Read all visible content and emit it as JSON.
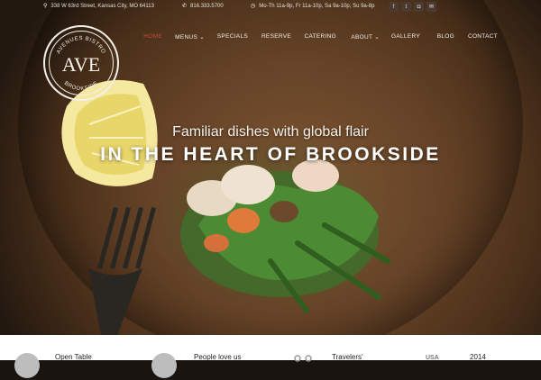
{
  "topbar": {
    "address": "338 W 63rd Street, Kansas City, MO 64113",
    "phone": "816.333.5700",
    "hours": "Mo-Th 11a-9p, Fr 11a-10p, Sa 9a-10p, Su 9a-8p",
    "social": [
      {
        "icon": "facebook-icon",
        "glyph": "f"
      },
      {
        "icon": "twitter-icon",
        "glyph": "t"
      },
      {
        "icon": "instagram-icon",
        "glyph": "◘"
      },
      {
        "icon": "email-icon",
        "glyph": "✉"
      }
    ]
  },
  "logo": {
    "arc_top": "AVENUES BISTRO",
    "monogram": "AVE",
    "arc_bottom": "BROOKSIDE"
  },
  "nav": {
    "items": [
      {
        "label": "HOME",
        "active": true
      },
      {
        "label": "MENUS",
        "dropdown": true
      },
      {
        "label": "SPECIALS"
      },
      {
        "label": "RESERVE"
      },
      {
        "label": "CATERING"
      },
      {
        "label": "ABOUT",
        "dropdown": true
      },
      {
        "label": "GALLERY"
      },
      {
        "label": "BLOG"
      },
      {
        "label": "CONTACT"
      }
    ],
    "accent_color": "#c94b3a"
  },
  "hero": {
    "tagline": "Familiar dishes with global flair",
    "headline": "IN THE HEART OF BROOKSIDE"
  },
  "awards": [
    {
      "label": "Open Table",
      "icon": "open-table-icon"
    },
    {
      "label": "People love us",
      "icon": "people-love-us-icon"
    },
    {
      "label": "Travelers'",
      "icon": "tripadvisor-icon"
    },
    {
      "label": "2014",
      "icon": "usa-badge-icon",
      "badge_text": "USA"
    }
  ]
}
